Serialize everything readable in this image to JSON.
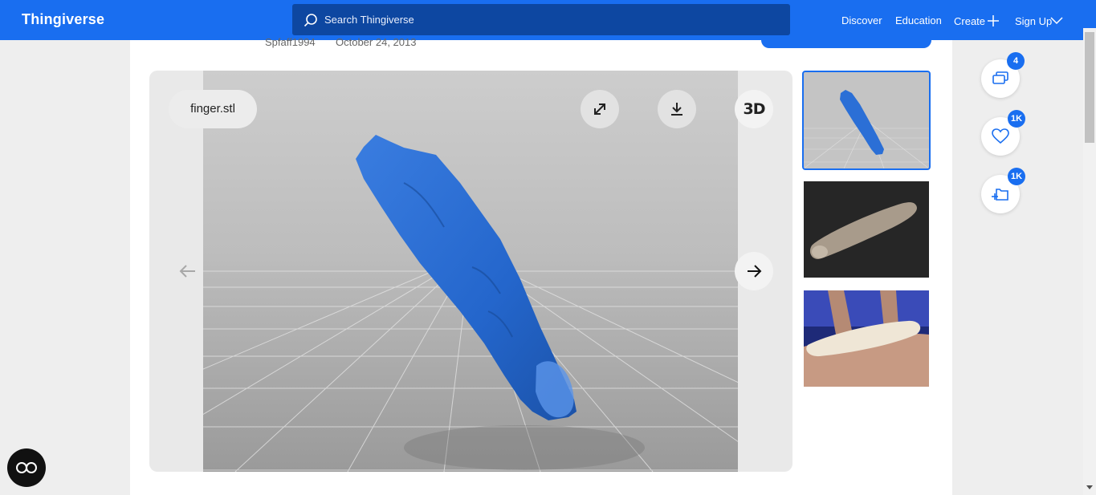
{
  "header": {
    "logo": "Thingiverse",
    "search_placeholder": "Search Thingiverse",
    "nav": {
      "discover": "Discover",
      "education": "Education",
      "create": "Create",
      "signup": "Sign Up"
    }
  },
  "thing": {
    "author": "Spfaff1994",
    "date": "October 24, 2013"
  },
  "viewer": {
    "file_name": "finger.stl",
    "three_d_label": "3D"
  },
  "thumbnails": [
    {
      "name": "blue-render",
      "selected": true
    },
    {
      "name": "gray-render-dark-bg",
      "selected": false
    },
    {
      "name": "printed-finger-photo",
      "selected": false
    }
  ],
  "actions": {
    "comments_count": "4",
    "likes_count": "1K",
    "collections_count": "1K"
  },
  "colors": {
    "brand": "#196ef0",
    "search_bg": "#0d47a1",
    "model_blue": "#2b6fd6"
  }
}
